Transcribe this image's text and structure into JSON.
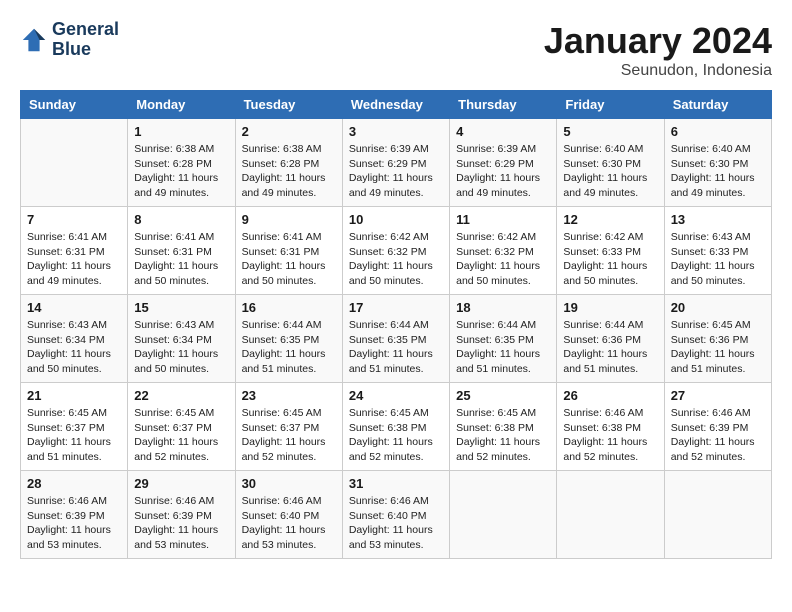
{
  "logo": {
    "line1": "General",
    "line2": "Blue"
  },
  "title": "January 2024",
  "subtitle": "Seunudon, Indonesia",
  "headers": [
    "Sunday",
    "Monday",
    "Tuesday",
    "Wednesday",
    "Thursday",
    "Friday",
    "Saturday"
  ],
  "weeks": [
    [
      {
        "day": "",
        "sunrise": "",
        "sunset": "",
        "daylight": ""
      },
      {
        "day": "1",
        "sunrise": "Sunrise: 6:38 AM",
        "sunset": "Sunset: 6:28 PM",
        "daylight": "Daylight: 11 hours and 49 minutes."
      },
      {
        "day": "2",
        "sunrise": "Sunrise: 6:38 AM",
        "sunset": "Sunset: 6:28 PM",
        "daylight": "Daylight: 11 hours and 49 minutes."
      },
      {
        "day": "3",
        "sunrise": "Sunrise: 6:39 AM",
        "sunset": "Sunset: 6:29 PM",
        "daylight": "Daylight: 11 hours and 49 minutes."
      },
      {
        "day": "4",
        "sunrise": "Sunrise: 6:39 AM",
        "sunset": "Sunset: 6:29 PM",
        "daylight": "Daylight: 11 hours and 49 minutes."
      },
      {
        "day": "5",
        "sunrise": "Sunrise: 6:40 AM",
        "sunset": "Sunset: 6:30 PM",
        "daylight": "Daylight: 11 hours and 49 minutes."
      },
      {
        "day": "6",
        "sunrise": "Sunrise: 6:40 AM",
        "sunset": "Sunset: 6:30 PM",
        "daylight": "Daylight: 11 hours and 49 minutes."
      }
    ],
    [
      {
        "day": "7",
        "sunrise": "Sunrise: 6:41 AM",
        "sunset": "Sunset: 6:31 PM",
        "daylight": "Daylight: 11 hours and 49 minutes."
      },
      {
        "day": "8",
        "sunrise": "Sunrise: 6:41 AM",
        "sunset": "Sunset: 6:31 PM",
        "daylight": "Daylight: 11 hours and 50 minutes."
      },
      {
        "day": "9",
        "sunrise": "Sunrise: 6:41 AM",
        "sunset": "Sunset: 6:31 PM",
        "daylight": "Daylight: 11 hours and 50 minutes."
      },
      {
        "day": "10",
        "sunrise": "Sunrise: 6:42 AM",
        "sunset": "Sunset: 6:32 PM",
        "daylight": "Daylight: 11 hours and 50 minutes."
      },
      {
        "day": "11",
        "sunrise": "Sunrise: 6:42 AM",
        "sunset": "Sunset: 6:32 PM",
        "daylight": "Daylight: 11 hours and 50 minutes."
      },
      {
        "day": "12",
        "sunrise": "Sunrise: 6:42 AM",
        "sunset": "Sunset: 6:33 PM",
        "daylight": "Daylight: 11 hours and 50 minutes."
      },
      {
        "day": "13",
        "sunrise": "Sunrise: 6:43 AM",
        "sunset": "Sunset: 6:33 PM",
        "daylight": "Daylight: 11 hours and 50 minutes."
      }
    ],
    [
      {
        "day": "14",
        "sunrise": "Sunrise: 6:43 AM",
        "sunset": "Sunset: 6:34 PM",
        "daylight": "Daylight: 11 hours and 50 minutes."
      },
      {
        "day": "15",
        "sunrise": "Sunrise: 6:43 AM",
        "sunset": "Sunset: 6:34 PM",
        "daylight": "Daylight: 11 hours and 50 minutes."
      },
      {
        "day": "16",
        "sunrise": "Sunrise: 6:44 AM",
        "sunset": "Sunset: 6:35 PM",
        "daylight": "Daylight: 11 hours and 51 minutes."
      },
      {
        "day": "17",
        "sunrise": "Sunrise: 6:44 AM",
        "sunset": "Sunset: 6:35 PM",
        "daylight": "Daylight: 11 hours and 51 minutes."
      },
      {
        "day": "18",
        "sunrise": "Sunrise: 6:44 AM",
        "sunset": "Sunset: 6:35 PM",
        "daylight": "Daylight: 11 hours and 51 minutes."
      },
      {
        "day": "19",
        "sunrise": "Sunrise: 6:44 AM",
        "sunset": "Sunset: 6:36 PM",
        "daylight": "Daylight: 11 hours and 51 minutes."
      },
      {
        "day": "20",
        "sunrise": "Sunrise: 6:45 AM",
        "sunset": "Sunset: 6:36 PM",
        "daylight": "Daylight: 11 hours and 51 minutes."
      }
    ],
    [
      {
        "day": "21",
        "sunrise": "Sunrise: 6:45 AM",
        "sunset": "Sunset: 6:37 PM",
        "daylight": "Daylight: 11 hours and 51 minutes."
      },
      {
        "day": "22",
        "sunrise": "Sunrise: 6:45 AM",
        "sunset": "Sunset: 6:37 PM",
        "daylight": "Daylight: 11 hours and 52 minutes."
      },
      {
        "day": "23",
        "sunrise": "Sunrise: 6:45 AM",
        "sunset": "Sunset: 6:37 PM",
        "daylight": "Daylight: 11 hours and 52 minutes."
      },
      {
        "day": "24",
        "sunrise": "Sunrise: 6:45 AM",
        "sunset": "Sunset: 6:38 PM",
        "daylight": "Daylight: 11 hours and 52 minutes."
      },
      {
        "day": "25",
        "sunrise": "Sunrise: 6:45 AM",
        "sunset": "Sunset: 6:38 PM",
        "daylight": "Daylight: 11 hours and 52 minutes."
      },
      {
        "day": "26",
        "sunrise": "Sunrise: 6:46 AM",
        "sunset": "Sunset: 6:38 PM",
        "daylight": "Daylight: 11 hours and 52 minutes."
      },
      {
        "day": "27",
        "sunrise": "Sunrise: 6:46 AM",
        "sunset": "Sunset: 6:39 PM",
        "daylight": "Daylight: 11 hours and 52 minutes."
      }
    ],
    [
      {
        "day": "28",
        "sunrise": "Sunrise: 6:46 AM",
        "sunset": "Sunset: 6:39 PM",
        "daylight": "Daylight: 11 hours and 53 minutes."
      },
      {
        "day": "29",
        "sunrise": "Sunrise: 6:46 AM",
        "sunset": "Sunset: 6:39 PM",
        "daylight": "Daylight: 11 hours and 53 minutes."
      },
      {
        "day": "30",
        "sunrise": "Sunrise: 6:46 AM",
        "sunset": "Sunset: 6:40 PM",
        "daylight": "Daylight: 11 hours and 53 minutes."
      },
      {
        "day": "31",
        "sunrise": "Sunrise: 6:46 AM",
        "sunset": "Sunset: 6:40 PM",
        "daylight": "Daylight: 11 hours and 53 minutes."
      },
      {
        "day": "",
        "sunrise": "",
        "sunset": "",
        "daylight": ""
      },
      {
        "day": "",
        "sunrise": "",
        "sunset": "",
        "daylight": ""
      },
      {
        "day": "",
        "sunrise": "",
        "sunset": "",
        "daylight": ""
      }
    ]
  ]
}
